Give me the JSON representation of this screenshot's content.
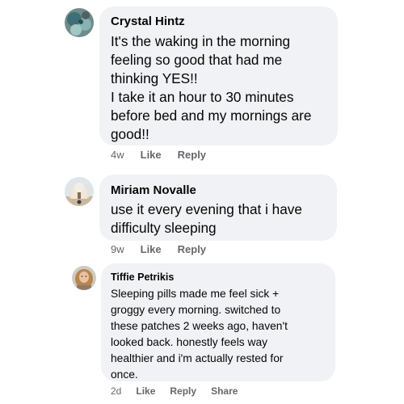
{
  "comments": [
    {
      "author": "Crystal Hintz",
      "avatar_icon": "profile-photo-icon",
      "text_lines": [
        "It's the waking in the morning",
        "feeling so good that had me",
        "thinking YES!!",
        "I take it an hour to 30 minutes",
        "before bed and my mornings are",
        "good!!"
      ],
      "time": "4w",
      "like_label": "Like",
      "reply_label": "Reply"
    },
    {
      "author": "Miriam Novalle",
      "avatar_icon": "profile-photo-icon",
      "text_lines": [
        "use it every evening that i have",
        "difficulty sleeping"
      ],
      "time": "9w",
      "like_label": "Like",
      "reply_label": "Reply"
    },
    {
      "author": "Tiffie Petrikis",
      "avatar_icon": "profile-photo-icon",
      "text_lines": [
        "Sleeping pills made me feel sick +",
        "groggy every morning. switched to",
        "these patches 2 weeks ago, haven't",
        "looked back. honestly feels way",
        "healthier and i'm actually rested for",
        "once."
      ],
      "time": "2d",
      "like_label": "Like",
      "reply_label": "Reply",
      "share_label": "Share"
    }
  ],
  "colors": {
    "bubble": "#f0f2f5",
    "text": "#050505",
    "meta": "#65676b"
  }
}
